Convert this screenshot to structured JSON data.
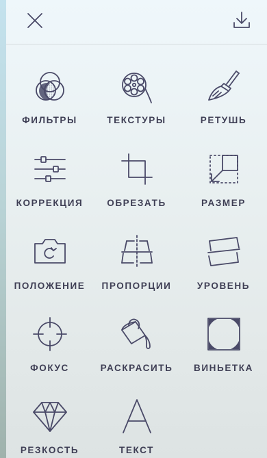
{
  "colors": {
    "icon_stroke": "#4a4a68",
    "label_text": "#3f3f55",
    "panel_top": "#eff7fb",
    "panel_bottom": "#dde3e3"
  },
  "header": {
    "close_icon": "close-icon",
    "download_icon": "download-icon"
  },
  "tools": [
    {
      "label": "ФИЛЬТРЫ",
      "icon": "filters-icon"
    },
    {
      "label": "ТЕКСТУРЫ",
      "icon": "film-reel-icon"
    },
    {
      "label": "РЕТУШЬ",
      "icon": "brush-icon"
    },
    {
      "label": "КОРРЕКЦИЯ",
      "icon": "sliders-icon"
    },
    {
      "label": "ОБРЕЗАТЬ",
      "icon": "crop-icon"
    },
    {
      "label": "РАЗМЕР",
      "icon": "resize-icon"
    },
    {
      "label": "ПОЛОЖЕНИЕ",
      "icon": "rotate-camera-icon"
    },
    {
      "label": "ПРОПОРЦИИ",
      "icon": "perspective-icon"
    },
    {
      "label": "УРОВЕНЬ",
      "icon": "straighten-icon"
    },
    {
      "label": "ФОКУС",
      "icon": "crosshair-icon"
    },
    {
      "label": "РАСКРАСИТЬ",
      "icon": "paint-bucket-icon"
    },
    {
      "label": "ВИНЬЕТКА",
      "icon": "vignette-icon"
    },
    {
      "label": "РЕЗКОСТЬ",
      "icon": "diamond-icon"
    },
    {
      "label": "ТЕКСТ",
      "icon": "text-icon"
    }
  ]
}
